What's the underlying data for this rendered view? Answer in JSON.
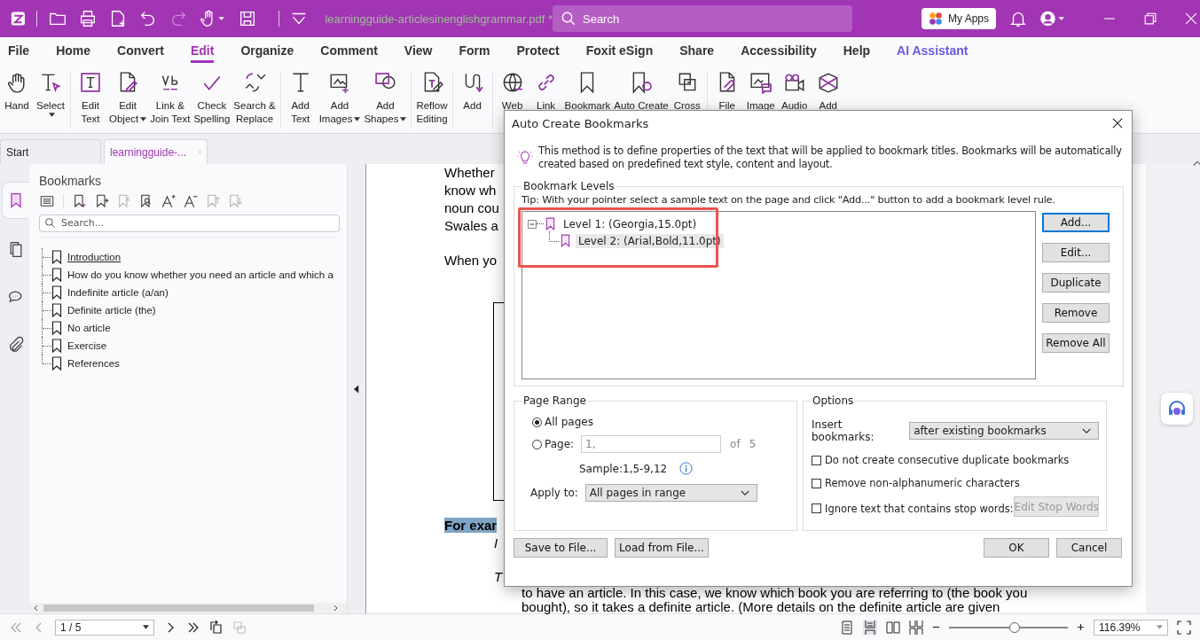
{
  "titlebar": {
    "filename": "learningguide-articlesinenglishgrammar.pdf *",
    "search_placeholder": "Search",
    "apps_button": "My Apps"
  },
  "menu": [
    {
      "label": "File",
      "selected": false,
      "kind": "menu"
    },
    {
      "label": "Home",
      "selected": false,
      "kind": "menu"
    },
    {
      "label": "Convert",
      "selected": false,
      "kind": "menu"
    },
    {
      "label": "Edit",
      "selected": true,
      "kind": "menu"
    },
    {
      "label": "Organize",
      "selected": false,
      "kind": "menu"
    },
    {
      "label": "Comment",
      "selected": false,
      "kind": "menu"
    },
    {
      "label": "View",
      "selected": false,
      "kind": "menu"
    },
    {
      "label": "Form",
      "selected": false,
      "kind": "menu"
    },
    {
      "label": "Protect",
      "selected": false,
      "kind": "menu"
    },
    {
      "label": "Foxit eSign",
      "selected": false,
      "kind": "menu"
    },
    {
      "label": "Share",
      "selected": false,
      "kind": "menu"
    },
    {
      "label": "Accessibility",
      "selected": false,
      "kind": "menu"
    },
    {
      "label": "Help",
      "selected": false,
      "kind": "menu"
    },
    {
      "label": "AI Assistant",
      "selected": false,
      "kind": "ai"
    }
  ],
  "ribbon": [
    [
      {
        "lines": [
          "Hand"
        ],
        "dropdown": false
      },
      {
        "lines": [
          "Select"
        ],
        "dropdown": true
      }
    ],
    [
      {
        "lines": [
          "Edit",
          "Text"
        ],
        "dropdown": false
      },
      {
        "lines": [
          "Edit",
          "Object"
        ],
        "dropdown": true
      },
      {
        "lines": [
          "Link &",
          "Join Text"
        ],
        "dropdown": false
      },
      {
        "lines": [
          "Check",
          "Spelling"
        ],
        "dropdown": false
      },
      {
        "lines": [
          "Search &",
          "Replace"
        ],
        "dropdown": false
      }
    ],
    [
      {
        "lines": [
          "Add",
          "Text"
        ],
        "dropdown": false
      },
      {
        "lines": [
          "Add",
          "Images"
        ],
        "dropdown": true
      },
      {
        "lines": [
          "Add",
          "Shapes"
        ],
        "dropdown": true
      }
    ],
    [
      {
        "lines": [
          "Reflow",
          "Editing"
        ],
        "dropdown": false
      }
    ],
    [
      {
        "lines": [
          "Add"
        ],
        "dropdown": false
      }
    ],
    [
      {
        "lines": [
          "Web"
        ],
        "dropdown": false
      },
      {
        "lines": [
          "Link"
        ],
        "dropdown": false
      },
      {
        "lines": [
          "Bookmark"
        ],
        "dropdown": false
      },
      {
        "lines": [
          "Auto Create"
        ],
        "dropdown": false
      },
      {
        "lines": [
          "Cross"
        ],
        "dropdown": false
      }
    ],
    [
      {
        "lines": [
          "File"
        ],
        "dropdown": false
      },
      {
        "lines": [
          "Image"
        ],
        "dropdown": false
      },
      {
        "lines": [
          "Audio"
        ],
        "dropdown": false
      },
      {
        "lines": [
          "Add"
        ],
        "dropdown": false
      }
    ]
  ],
  "tabs": [
    {
      "label": "Start",
      "selected": false
    },
    {
      "label": "learningguide-...",
      "selected": true
    }
  ],
  "side_tabs": [
    {
      "selected": true
    },
    {
      "selected": false
    },
    {
      "selected": false
    },
    {
      "selected": false
    }
  ],
  "bookmarks": {
    "title": "Bookmarks",
    "search_placeholder": "Search...",
    "items": [
      {
        "label": "Introduction",
        "selected": true
      },
      {
        "label": "How do you know whether you need an article and which a",
        "selected": false
      },
      {
        "label": "Indefinite article (a/an)",
        "selected": false
      },
      {
        "label": "Definite article (the)",
        "selected": false
      },
      {
        "label": "No article",
        "selected": false
      },
      {
        "label": "Exercise",
        "selected": false
      },
      {
        "label": "References",
        "selected": false
      }
    ]
  },
  "doc": {
    "top_lines": [
      "Whether",
      "know wh",
      "noun cou",
      "Swales a"
    ],
    "when_line": "When yo",
    "example": "For exar",
    "italic_lines": [
      "I",
      "T"
    ],
    "bottom_lines": [
      "to have an article. In this case, we know which book you are referring to (the book you",
      "bought), so it takes a definite article. (More details on the definite article are given"
    ]
  },
  "dialog": {
    "title": "Auto Create Bookmarks",
    "description": "This method is to define properties of the text that will be applied to bookmark titles. Bookmarks will be automatically created based on predefined text style, content and layout.",
    "levels": {
      "legend": "Bookmark Levels",
      "tip": "Tip: With your pointer select a sample text on the page and click \"Add...\" button to add a bookmark level rule.",
      "annotation_frame": true,
      "tree": [
        {
          "label": "Level 1: (Georgia,15.0pt)",
          "expanded": true,
          "selected": false,
          "children": [
            {
              "label": "Level 2: (Arial,Bold,11.0pt)",
              "selected": true
            }
          ]
        }
      ],
      "buttons": [
        {
          "label": "Add...",
          "default": true
        },
        {
          "label": "Edit...",
          "default": false
        },
        {
          "label": "Duplicate",
          "default": false
        },
        {
          "label": "Remove",
          "default": false
        },
        {
          "label": "Remove All",
          "default": false
        }
      ]
    },
    "page_range": {
      "legend": "Page Range",
      "options": [
        {
          "label": "All pages",
          "selected": true
        },
        {
          "label": "Page:",
          "selected": false
        }
      ],
      "page_value": "1,",
      "of": "of",
      "total": "5",
      "sample": "Sample:1,5-9,12",
      "apply_label": "Apply to:",
      "apply_value": "All pages in range"
    },
    "options": {
      "legend": "Options",
      "insert_label": "Insert bookmarks:",
      "insert_value": "after existing bookmarks",
      "checks": [
        {
          "label": "Do not create consecutive duplicate bookmarks",
          "checked": false
        },
        {
          "label": "Remove non-alphanumeric characters",
          "checked": false
        },
        {
          "label": "Ignore text that contains stop words:",
          "checked": false
        }
      ],
      "stop_words_button": {
        "label": "Edit Stop Words",
        "disabled": true
      }
    },
    "footer_left": [
      "Save to File...",
      "Load from File..."
    ],
    "footer_right": [
      "OK",
      "Cancel"
    ]
  },
  "bottom": {
    "page": "1 / 5",
    "zoom": "116.39%",
    "zoom_slider": {
      "level": 0.55
    }
  }
}
